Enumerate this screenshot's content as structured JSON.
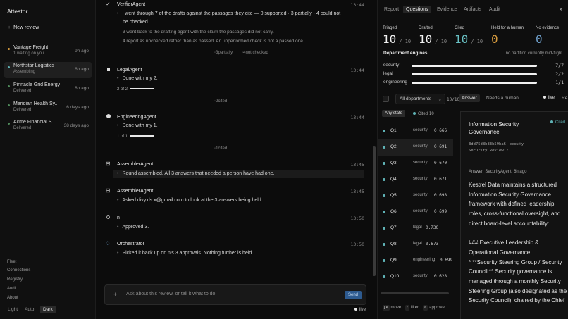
{
  "app": {
    "name": "Attestor"
  },
  "sidebar": {
    "new_review": "New review",
    "projects": [
      {
        "name": "Vantage Freight",
        "sub": "1 waiting on you",
        "age": "9h ago",
        "dot": "#d59a3e"
      },
      {
        "name": "Northstar Logistics",
        "sub": "Assembling",
        "age": "6h ago",
        "dot": "#5fb3b6"
      },
      {
        "name": "Pinnacle Grid Energy",
        "sub": "Delivered",
        "age": "8h ago",
        "dot": "#4f8a5b"
      },
      {
        "name": "Meridian Health Sy...",
        "sub": "Delivered",
        "age": "6 days ago",
        "dot": "#4f8a5b"
      },
      {
        "name": "Acme Financial S...",
        "sub": "Delivered",
        "age": "38 days ago",
        "dot": "#4f8a5b"
      }
    ],
    "nav": [
      "Fleet",
      "Connections",
      "Registry",
      "Audit",
      "About"
    ],
    "theme": [
      "Light",
      "Auto",
      "Dark"
    ],
    "theme_selected": "Dark"
  },
  "timeline": {
    "events": [
      {
        "agent": "VerifierAgent",
        "time": "13:44",
        "lines": [
          "I went through 7 of the drafts against the passages they cite — 0 supported · 3 partially · 4 could not",
          "be checked."
        ],
        "subs": [
          "3 went back to the drafting agent with the claim the passages did not carry.",
          "4 report as unchecked rather than as passed. An unperformed check is not a passed one."
        ],
        "chips": [
          "3partially",
          "4not checked"
        ]
      },
      {
        "agent": "LegalAgent",
        "time": "13:44",
        "line": "Done with my 2.",
        "progress": "2 of 2",
        "chip": "2cited"
      },
      {
        "agent": "EngineeringAgent",
        "time": "13:44",
        "line": "Done with my 1.",
        "progress": "1 of 1",
        "chip": "1cited"
      },
      {
        "agent": "AssemblerAgent",
        "time": "13:45",
        "line": "Round assembled. All 3 answers that needed a person have had one."
      },
      {
        "agent": "AssemblerAgent",
        "time": "13:45",
        "line": "Asked divy.ds.x@gmail.com to look at the 3 answers being held."
      },
      {
        "agent": "n",
        "time": "13:50",
        "line": "Approved 3."
      },
      {
        "agent": "Orchestrator",
        "time": "13:50",
        "line": "Picked it back up on n's 3 approvals. Nothing further is held."
      }
    ]
  },
  "composer": {
    "placeholder": "Ask about this review, or tell it what to do",
    "send": "Send",
    "live": "live"
  },
  "panel": {
    "tabs": [
      "Report",
      "Questions",
      "Evidence",
      "Artifacts",
      "Audit"
    ],
    "selected_tab": "Questions",
    "close": "×",
    "stats": [
      {
        "label": "Triaged",
        "value": "10",
        "of": "/ 10"
      },
      {
        "label": "Drafted",
        "value": "10",
        "of": "/ 10"
      },
      {
        "label": "Cited",
        "value": "10",
        "of": "/ 10"
      },
      {
        "label": "Held for a human",
        "value": "0",
        "of": ""
      },
      {
        "label": "No evidence",
        "value": "0",
        "of": ""
      }
    ],
    "departments_title": "Department engines",
    "departments_note": "no partition currently mid-flight",
    "departments": [
      {
        "name": "security",
        "count": "7/7",
        "progress": 1.0
      },
      {
        "name": "legal",
        "count": "2/2",
        "progress": 1.0
      },
      {
        "name": "engineering",
        "count": "1/1",
        "progress": 1.0
      }
    ],
    "filter": {
      "department": "All departments",
      "count": "10/10",
      "any_state": "Any state",
      "cited_label": "Cited",
      "cited_count": "10"
    },
    "questions": [
      {
        "id": "Q1",
        "dept": "security",
        "score": "0.666"
      },
      {
        "id": "Q2",
        "dept": "security",
        "score": "0.691"
      },
      {
        "id": "Q3",
        "dept": "security",
        "score": "0.670"
      },
      {
        "id": "Q4",
        "dept": "security",
        "score": "0.671"
      },
      {
        "id": "Q5",
        "dept": "security",
        "score": "0.698"
      },
      {
        "id": "Q6",
        "dept": "security",
        "score": "0.699"
      },
      {
        "id": "Q7",
        "dept": "legal",
        "score": "0.730"
      },
      {
        "id": "Q8",
        "dept": "legal",
        "score": "0.673"
      },
      {
        "id": "Q9",
        "dept": "engineering",
        "score": "0.699"
      },
      {
        "id": "Q10",
        "dept": "security",
        "score": "0.628"
      }
    ],
    "hints": [
      {
        "key": "j k",
        "label": "move"
      },
      {
        "key": "/",
        "label": "filter"
      },
      {
        "key": "a",
        "label": "approve"
      }
    ],
    "detail_tabs": {
      "answer": "Answer",
      "human": "Needs a human",
      "live": "live",
      "re": "Re"
    },
    "detail": {
      "title": "Information Security Governance",
      "badge": "Cited",
      "hash": "3dd75d8b83b59ba6",
      "dept": "security",
      "ref": "Security Review:7",
      "answer_label": "Answer",
      "answer_agent": "SecurityAgent",
      "answer_age": "6h ago",
      "body": "Kestrel Data maintains a structured Information Security Governance framework with defined leadership roles, cross-functional oversight, and direct board-level accountability:\n\n### Executive Leadership & Operational Governance\n* **Security Steering Group / Security Council:** Security governance is managed through a monthly Security Steering Group (also designated as the Security Council), chaired by the Chief"
    }
  }
}
